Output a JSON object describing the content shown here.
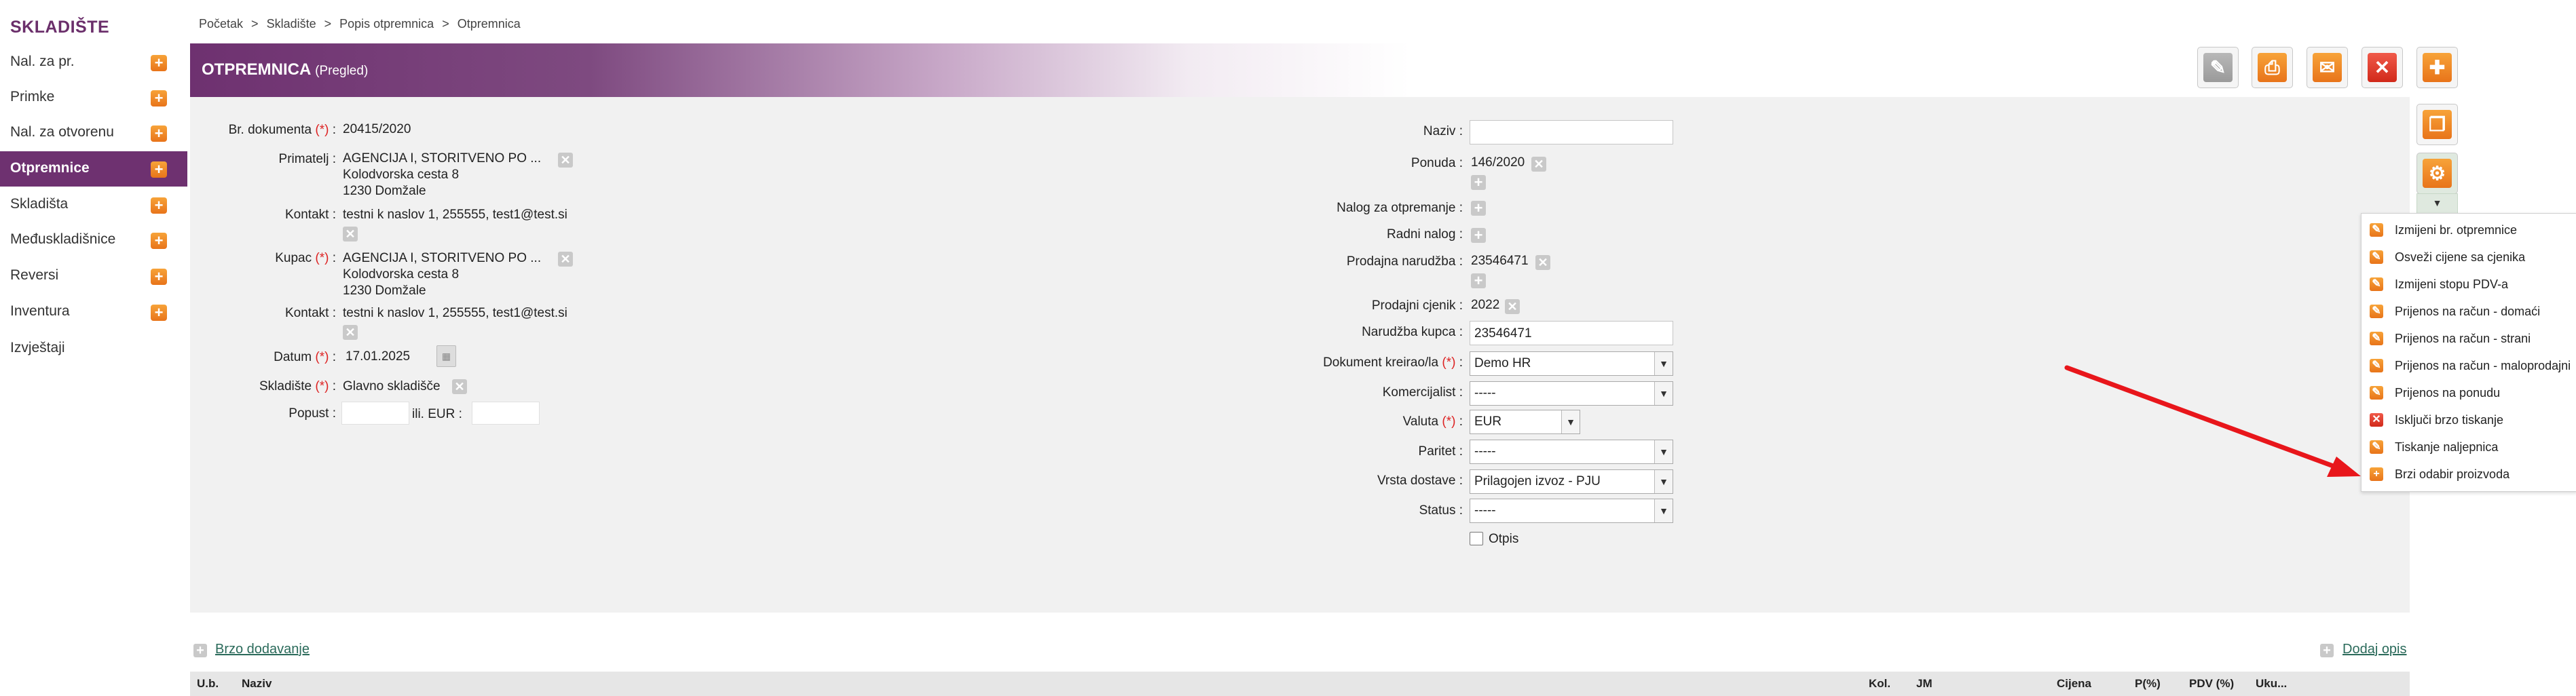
{
  "sidebar": {
    "title": "SKLADIŠTE",
    "items": [
      {
        "label": "Nal. za pr.",
        "plus": true
      },
      {
        "label": "Primke",
        "plus": true
      },
      {
        "label": "Nal. za otvorenu",
        "plus": true
      },
      {
        "label": "Otpremnice",
        "plus": true,
        "active": true
      },
      {
        "label": "Skladišta",
        "plus": true
      },
      {
        "label": "Međuskladišnice",
        "plus": true
      },
      {
        "label": "Reversi",
        "plus": true
      },
      {
        "label": "Inventura",
        "plus": true
      },
      {
        "label": "Izvještaji",
        "plus": false
      }
    ]
  },
  "breadcrumb": [
    "Početak",
    "Skladište",
    "Popis otpremnica",
    "Otpremnica"
  ],
  "breadcrumb_sep": ">",
  "header": {
    "title": "OTPREMNICA",
    "subtitle": "(Pregled)"
  },
  "form_left": {
    "br_dokumenta": {
      "label": "Br. dokumenta",
      "req": "(*)",
      "value": "20415/2020"
    },
    "primatelj": {
      "label": "Primatelj :",
      "lines": [
        "AGENCIJA I, STORITVENO PO ...",
        "Kolodvorska cesta 8",
        "1230 Domžale"
      ]
    },
    "kontakt1": {
      "label": "Kontakt :",
      "value": "testni k naslov 1, 255555, test1@test.si"
    },
    "kupac": {
      "label": "Kupac",
      "req": "(*)",
      "lines": [
        "AGENCIJA I, STORITVENO PO ...",
        "Kolodvorska cesta 8",
        "1230 Domžale"
      ]
    },
    "kontakt2": {
      "label": "Kontakt :",
      "value": "testni k naslov 1, 255555, test1@test.si"
    },
    "datum": {
      "label": "Datum",
      "req": "(*)",
      "value": "17.01.2025"
    },
    "skladiste": {
      "label": "Skladište",
      "req": "(*)",
      "value": "Glavno skladišče"
    },
    "popust": {
      "label": "Popust :",
      "ili": "ili",
      "eur": "EUR :"
    }
  },
  "form_right": {
    "naziv": {
      "label": "Naziv :",
      "value": ""
    },
    "ponuda": {
      "label": "Ponuda :",
      "value": "146/2020"
    },
    "nalog_otpremanje": {
      "label": "Nalog za otpremanje :"
    },
    "radni_nalog": {
      "label": "Radni nalog :"
    },
    "prodajna_narudzba": {
      "label": "Prodajna narudžba :",
      "value": "23546471"
    },
    "prodajni_cjenik": {
      "label": "Prodajni cjenik :",
      "value": "2022"
    },
    "narudzba_kupca": {
      "label": "Narudžba kupca :",
      "value": "23546471"
    },
    "dokument_kreirao": {
      "label": "Dokument kreirao/la",
      "req": "(*)",
      "value": "Demo HR"
    },
    "komercijalist": {
      "label": "Komercijalist :",
      "value": "-----"
    },
    "valuta": {
      "label": "Valuta",
      "req": "(*)",
      "value": "EUR"
    },
    "paritet": {
      "label": "Paritet :",
      "value": "-----"
    },
    "vrsta_dostave": {
      "label": "Vrsta dostave :",
      "value": "Prilagojen izvoz - PJU"
    },
    "status": {
      "label": "Status :",
      "value": "-----"
    },
    "otpis": {
      "label": "Otpis",
      "checked": false
    }
  },
  "links": {
    "brzo_dodavanje": "Brzo dodavanje",
    "dodaj_opis": "Dodaj opis"
  },
  "table_headers": [
    "U.b.",
    "Naziv",
    "Kol.",
    "JM",
    "Cijena",
    "P(%)",
    "PDV (%)",
    "Uku..."
  ],
  "dropdown_menu": [
    {
      "label": "Izmijeni br. otpremnice",
      "icon": "edit-icon"
    },
    {
      "label": "Osveži cijene sa cjenika",
      "icon": "edit-icon"
    },
    {
      "label": "Izmijeni stopu PDV-a",
      "icon": "edit-icon"
    },
    {
      "label": "Prijenos na račun - domaći",
      "icon": "edit-icon"
    },
    {
      "label": "Prijenos na račun - strani",
      "icon": "edit-icon"
    },
    {
      "label": "Prijenos na račun - maloprodajni",
      "icon": "edit-icon"
    },
    {
      "label": "Prijenos na ponudu",
      "icon": "edit-icon"
    },
    {
      "label": "Isključi brzo tiskanje",
      "icon": "close-icon"
    },
    {
      "label": "Tiskanje naljepnica",
      "icon": "edit-icon"
    },
    {
      "label": "Brzi odabir proizvoda",
      "icon": "plus-icon"
    }
  ],
  "colors": {
    "brand": "#6e3170",
    "accent_orange": "#f08a24",
    "danger": "#e03a2a",
    "annotation_arrow": "#e8161b"
  }
}
